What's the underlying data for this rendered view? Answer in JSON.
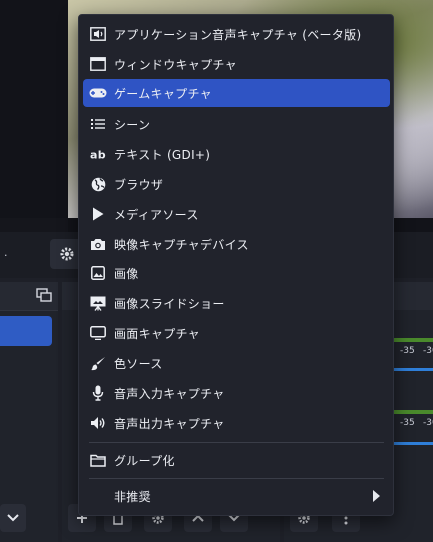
{
  "menu": {
    "items": [
      {
        "label": "アプリケーション音声キャプチャ (ベータ版)",
        "icon": "speaker-window-icon"
      },
      {
        "label": "ウィンドウキャプチャ",
        "icon": "window-icon"
      },
      {
        "label": "ゲームキャプチャ",
        "icon": "gamepad-icon",
        "selected": true
      },
      {
        "label": "シーン",
        "icon": "list-icon"
      },
      {
        "label": "テキスト (GDI+)",
        "icon": "text-ab-icon"
      },
      {
        "label": "ブラウザ",
        "icon": "globe-icon"
      },
      {
        "label": "メディアソース",
        "icon": "play-icon"
      },
      {
        "label": "映像キャプチャデバイス",
        "icon": "camera-icon"
      },
      {
        "label": "画像",
        "icon": "image-icon"
      },
      {
        "label": "画像スライドショー",
        "icon": "slideshow-icon"
      },
      {
        "label": "画面キャプチャ",
        "icon": "monitor-icon"
      },
      {
        "label": "色ソース",
        "icon": "brush-icon"
      },
      {
        "label": "音声入力キャプチャ",
        "icon": "microphone-icon"
      },
      {
        "label": "音声出力キャプチャ",
        "icon": "speaker-icon"
      }
    ],
    "group_label": "グループ化",
    "deprecated_label": "非推奨"
  },
  "control_bar": {
    "label": "."
  },
  "mixer": {
    "db_values": [
      "-35",
      "-30",
      "-35",
      "-30"
    ]
  },
  "colors": {
    "accent": "#2f54c4",
    "menu_bg": "#21232c",
    "panel_bg": "#20232b",
    "meter_green": "#4a8a2c",
    "meter_blue": "#2f7fd9"
  }
}
